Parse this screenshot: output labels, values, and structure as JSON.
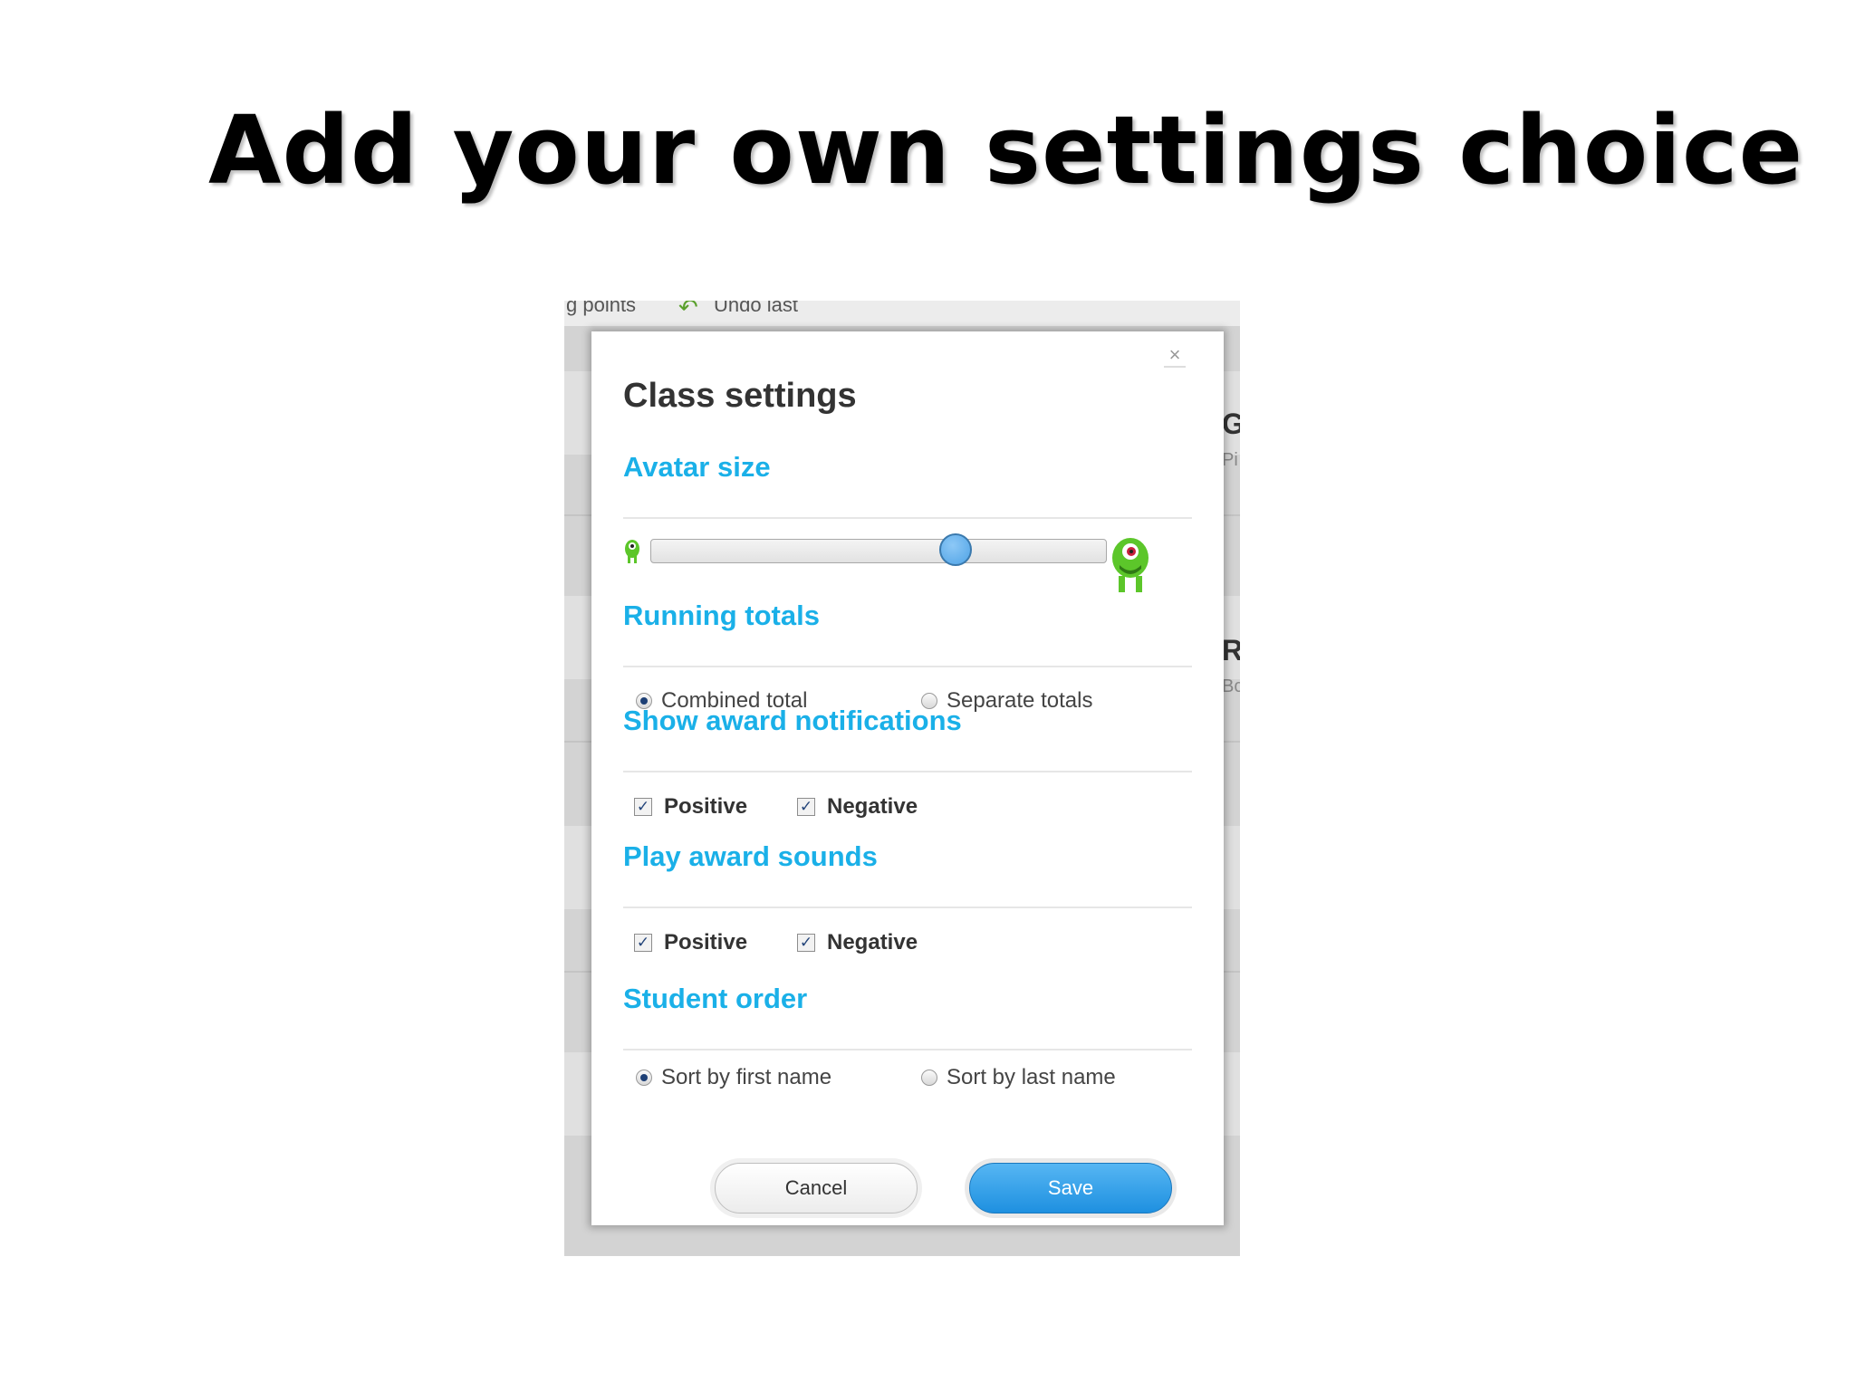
{
  "slide": {
    "title": "Add your own settings choice"
  },
  "background_app": {
    "toolbar_left": "g points",
    "toolbar_undo": "Undo last",
    "side_letters": [
      "G",
      "R"
    ],
    "side_subtext": [
      "Pi",
      "Bc"
    ]
  },
  "dialog": {
    "title": "Class settings",
    "close_label": "×",
    "avatar_size": {
      "heading": "Avatar size",
      "slider_value": 0.67
    },
    "running_totals": {
      "heading": "Running totals",
      "options": [
        {
          "label": "Combined total",
          "selected": true
        },
        {
          "label": "Separate totals",
          "selected": false
        }
      ]
    },
    "award_notifications": {
      "heading": "Show award notifications",
      "positive": {
        "label": "Positive",
        "checked": true
      },
      "negative": {
        "label": "Negative",
        "checked": true
      }
    },
    "award_sounds": {
      "heading": "Play award sounds",
      "positive": {
        "label": "Positive",
        "checked": true
      },
      "negative": {
        "label": "Negative",
        "checked": true
      }
    },
    "student_order": {
      "heading": "Student order",
      "options": [
        {
          "label": "Sort by first name",
          "selected": true
        },
        {
          "label": "Sort by last name",
          "selected": false
        }
      ]
    },
    "cancel_label": "Cancel",
    "save_label": "Save"
  },
  "colors": {
    "heading_blue": "#1ab0e8",
    "save_blue": "#1e90e0",
    "monster_green": "#5cc62a"
  }
}
